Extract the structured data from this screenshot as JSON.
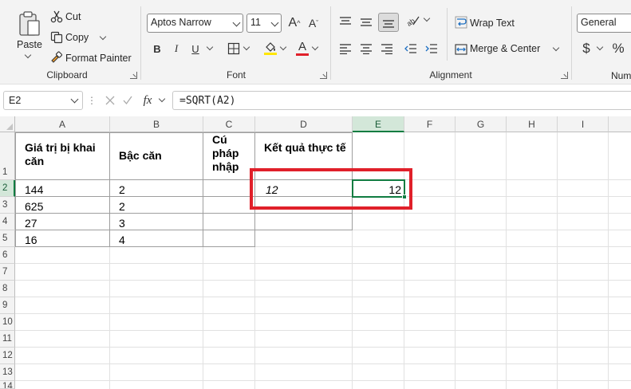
{
  "ribbon": {
    "clipboard": {
      "paste_label": "Paste",
      "cut_label": "Cut",
      "copy_label": "Copy",
      "format_painter_label": "Format Painter",
      "group_label": "Clipboard"
    },
    "font": {
      "font_name": "Aptos Narrow",
      "font_size": "11",
      "grow_label": "A",
      "shrink_label": "A",
      "bold_label": "B",
      "italic_label": "I",
      "underline_label": "U",
      "font_color_label": "A",
      "fill_color": "#ffe600",
      "font_color": "#e0202a",
      "group_label": "Font"
    },
    "alignment": {
      "wrap_text_label": "Wrap Text",
      "merge_center_label": "Merge & Center",
      "group_label": "Alignment"
    },
    "number": {
      "format_value": "General",
      "currency_label": "$",
      "percent_label": "%",
      "group_label": "Num"
    }
  },
  "formula_bar": {
    "name_box": "E2",
    "fx_label": "fx",
    "formula": "=SQRT(A2)"
  },
  "columns": [
    "A",
    "B",
    "C",
    "D",
    "E",
    "F",
    "G",
    "H",
    "I"
  ],
  "rows": [
    "1",
    "2",
    "3",
    "4",
    "5",
    "6",
    "7",
    "8",
    "9",
    "10",
    "11",
    "12",
    "13",
    "14"
  ],
  "cells": {
    "A1": "Giá trị bị khai căn",
    "B1": "Bậc căn",
    "C1": "Cú pháp nhập",
    "D1": "Kết quả thực tế",
    "A2": "144",
    "B2": "2",
    "D2": "12",
    "E2": "12",
    "A3": "625",
    "B3": "2",
    "A4": "27",
    "B4": "3",
    "A5": "16",
    "B5": "4"
  },
  "colors": {
    "accent_green": "#107c41",
    "highlight_red": "#e0202a"
  }
}
